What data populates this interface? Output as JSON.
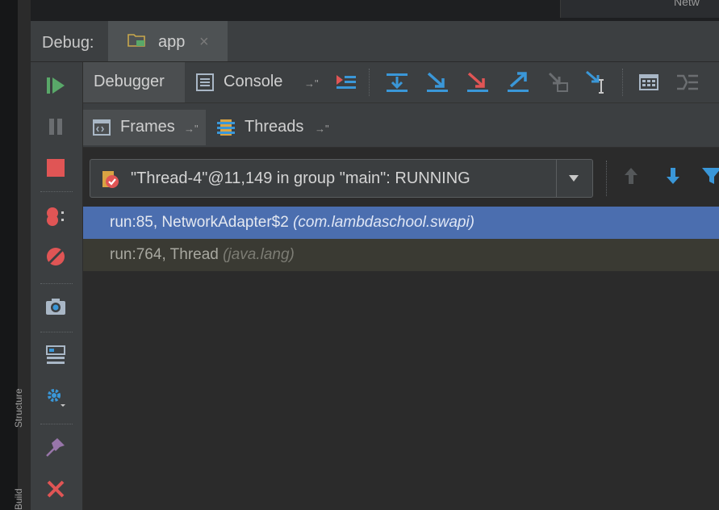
{
  "window": {
    "top_right_tab": "Netw",
    "side_labels": [
      "Structure",
      "Build"
    ]
  },
  "debug_header": {
    "label": "Debug:",
    "session_tab": {
      "label": "app",
      "icon": "folder-run-icon",
      "close": "×"
    }
  },
  "tabs": {
    "debugger": "Debugger",
    "console": "Console",
    "pin": "→\""
  },
  "subtabs": {
    "frames": "Frames",
    "threads": "Threads",
    "pin": "→\""
  },
  "thread_selector": {
    "value": "\"Thread-4\"@11,149 in group \"main\": RUNNING"
  },
  "frames": [
    {
      "method": "run:85, NetworkAdapter$2",
      "package": "(com.lambdaschool.swapi)",
      "selected": true
    },
    {
      "method": "run:764, Thread",
      "package": "(java.lang)",
      "selected": false
    }
  ],
  "colors": {
    "selection": "#4b6eaf",
    "library_row": "#3a3a33",
    "resume_green": "#59a869",
    "stop_red": "#e05555",
    "step_blue": "#3a97d8"
  }
}
